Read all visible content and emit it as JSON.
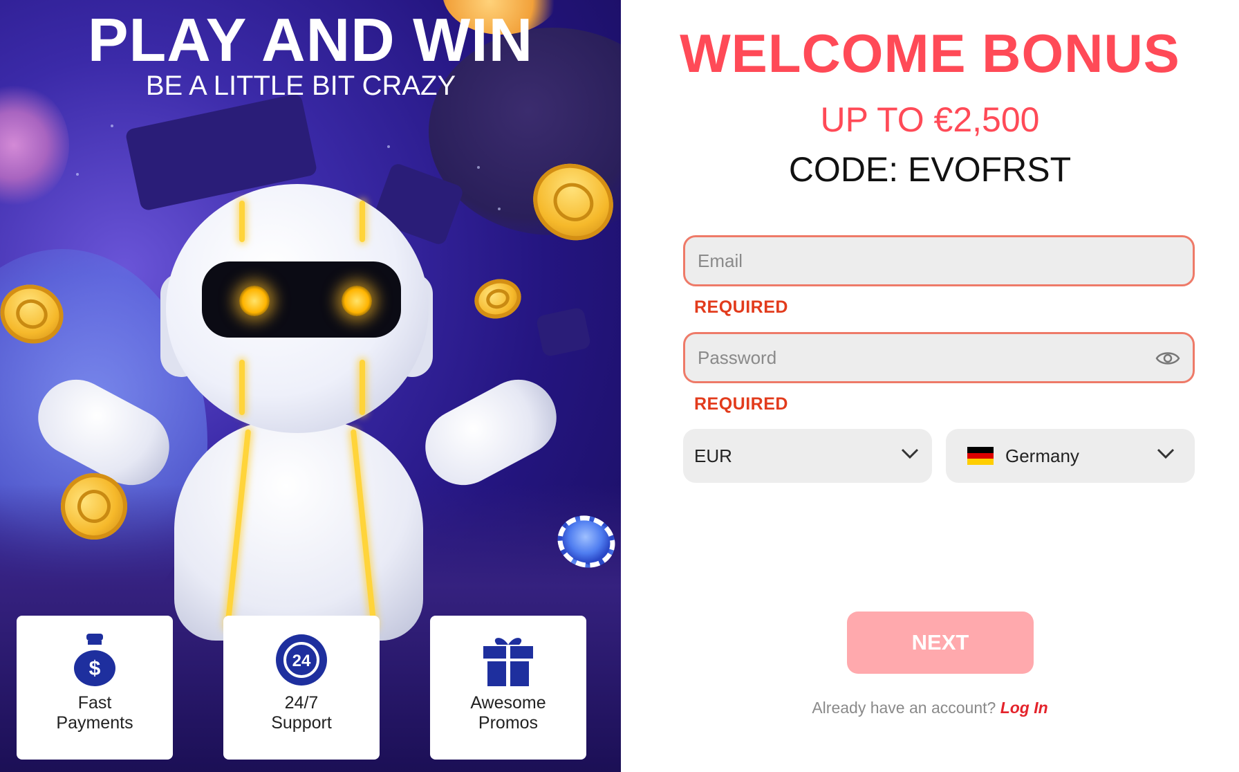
{
  "promo": {
    "title": "PLAY AND WIN",
    "subtitle": "BE A LITTLE BIT CRAZY",
    "features": [
      {
        "label_line1": "Fast",
        "label_line2": "Payments",
        "icon": "money-bag-icon"
      },
      {
        "label_line1": "24/7",
        "label_line2": "Support",
        "icon": "support-24-icon"
      },
      {
        "label_line1": "Awesome",
        "label_line2": "Promos",
        "icon": "gift-icon"
      }
    ]
  },
  "form": {
    "heading": "WELCOME BONUS",
    "offer": "UP TO €2,500",
    "code": "CODE: EVOFRST",
    "email": {
      "placeholder": "Email",
      "value": "",
      "error": "REQUIRED"
    },
    "password": {
      "placeholder": "Password",
      "value": "",
      "error": "REQUIRED",
      "icon": "eye-icon"
    },
    "currency": {
      "selected": "EUR",
      "icon": "chevron-down-icon"
    },
    "country": {
      "selected": "Germany",
      "flag": "germany-flag-icon",
      "icon": "chevron-down-icon"
    },
    "next_label": "NEXT",
    "login_prompt": "Already have an account?",
    "login_link": "Log In"
  },
  "colors": {
    "accent": "#ff4a57",
    "error": "#e23b1c",
    "field_border": "#ee7a68",
    "next_button": "#ffa9ad",
    "feature_icon": "#1e2f9e"
  }
}
